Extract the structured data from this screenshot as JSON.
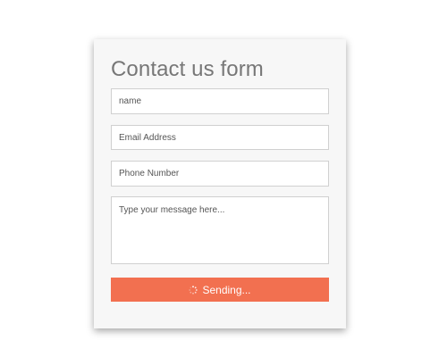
{
  "form": {
    "title": "Contact us form",
    "name_placeholder": "name",
    "email_placeholder": "Email Address",
    "phone_placeholder": "Phone Number",
    "message_placeholder": "Type your message here...",
    "submit_label": "Sending...",
    "submit_icon": "loading-spinner-icon"
  },
  "colors": {
    "accent": "#f27050",
    "card_background": "#f7f7f7",
    "title_text": "#777777",
    "field_border": "#d0d0d0"
  }
}
